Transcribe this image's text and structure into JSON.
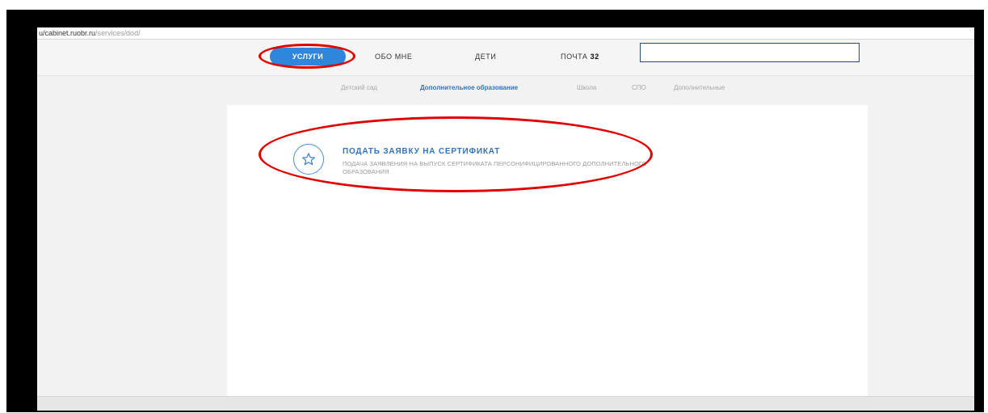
{
  "browser": {
    "url_host": "u/cabinet.ruobr.ru",
    "url_path": "/services/dod/"
  },
  "topnav": {
    "items": [
      {
        "label": "УСЛУГИ",
        "active": true
      },
      {
        "label": "ОБО МНЕ"
      },
      {
        "label": "ДЕТИ"
      },
      {
        "label": "ПОЧТА",
        "count": "32"
      }
    ],
    "search_value": ""
  },
  "subnav": {
    "items": [
      {
        "label": "Детский сад"
      },
      {
        "label": "Дополнительное образование",
        "active": true
      },
      {
        "label": "Школа"
      },
      {
        "label": "СПО"
      },
      {
        "label": "Дополнительные"
      }
    ]
  },
  "service": {
    "title": "ПОДАТЬ ЗАЯВКУ НА СЕРТИФИКАТ",
    "description": "ПОДАЧА ЗАЯВЛЕНИЯ НА ВЫПУСК СЕРТИФИКАТА ПЕРСОНИФИЦИРОВАННОГО ДОПОЛНИТЕЛЬНОГО ОБРАЗОВАНИЯ",
    "icon": "star-icon"
  },
  "colors": {
    "accent": "#2f87dc",
    "link": "#3273c0",
    "annotation": "#e00000"
  }
}
